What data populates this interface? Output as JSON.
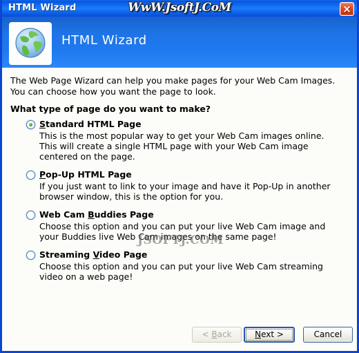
{
  "window": {
    "title": "HTML Wizard",
    "title_watermark": "WwW.JsoftJ.CoM",
    "body_watermark": "JSOFTJ.COM",
    "close_glyph": "×",
    "colors": {
      "titlebar_blue": "#0b63ee",
      "frame_blue": "#0a46d2",
      "banner_blue": "#1f79ef",
      "panel_background": "#fcfdf9",
      "close_red": "#e24a24",
      "radio_dot_green": "#43a814",
      "default_button_border": "#2a56a8"
    }
  },
  "banner": {
    "title": "HTML Wizard",
    "icon": "globe-icon"
  },
  "main": {
    "intro": "The Web Page Wizard can help you make pages for your Web Cam Images. You can choose how you want the page to look.",
    "question": "What type of page do you want to make?",
    "options": [
      {
        "label_before": "",
        "accel": "S",
        "label_after": "tandard HTML Page",
        "description": "This is the most popular way to get your Web Cam images online. This will create a single HTML page with your Web Cam image centered on the page.",
        "selected": true
      },
      {
        "label_before": "",
        "accel": "P",
        "label_after": "op-Up HTML Page",
        "description": "If you just want to link to your image and have it Pop-Up in another browser window, this is the option for you.",
        "selected": false
      },
      {
        "label_before": "Web Cam ",
        "accel": "B",
        "label_after": "uddies Page",
        "description": "Choose this option and you can put your live Web Cam image and your Buddies live Web Cam images on the same page!",
        "selected": false
      },
      {
        "label_before": "Streaming ",
        "accel": "V",
        "label_after": "ideo Page",
        "description": "Choose this option and you can put your live Web Cam streaming video on a web page!",
        "selected": false
      }
    ]
  },
  "footer": {
    "back": {
      "before": "< ",
      "accel": "B",
      "after": "ack",
      "enabled": false
    },
    "next": {
      "before": "",
      "accel": "N",
      "after": "ext >",
      "default": true
    },
    "cancel": {
      "label": "Cancel"
    }
  }
}
